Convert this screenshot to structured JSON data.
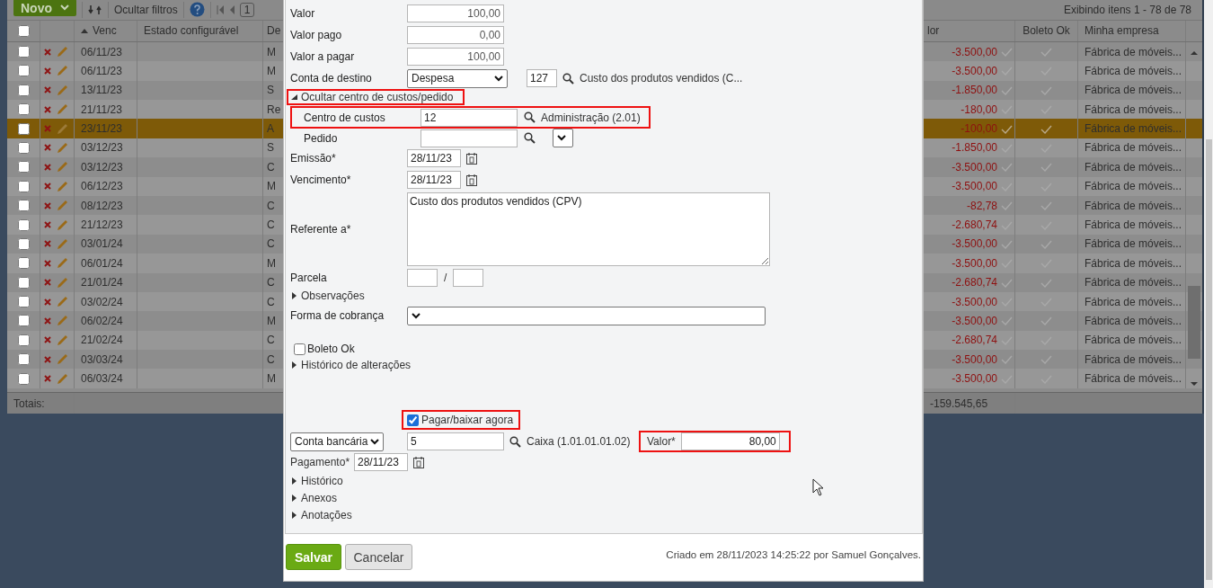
{
  "toolbar": {
    "new_button": "Novo",
    "filter_button": "Ocultar filtros",
    "page": "1",
    "items_info": "Exibindo itens 1 - 78 de 78"
  },
  "grid": {
    "all_checked": false,
    "columns": [
      {
        "label": "Venc",
        "sorted": true
      },
      {
        "label": "Estado configurável",
        "sorted": false
      },
      {
        "label": "De",
        "sorted": false
      },
      {
        "label": "lor",
        "sorted": false
      },
      {
        "label": "Boleto Ok",
        "sorted": false
      },
      {
        "label": "Minha empresa",
        "sorted": false
      }
    ],
    "rows": [
      {
        "selected": false,
        "checked": false,
        "venc": "06/11/23",
        "de": "M",
        "valor": "-3.500,00",
        "empresa": "Fábrica de móveis..."
      },
      {
        "selected": false,
        "checked": false,
        "venc": "06/11/23",
        "de": "M",
        "valor": "-3.500,00",
        "empresa": "Fábrica de móveis..."
      },
      {
        "selected": false,
        "checked": false,
        "venc": "13/11/23",
        "de": "S",
        "valor": "-1.850,00",
        "empresa": "Fábrica de móveis..."
      },
      {
        "selected": false,
        "checked": false,
        "venc": "21/11/23",
        "de": "Re",
        "valor": "-180,00",
        "empresa": "Fábrica de móveis..."
      },
      {
        "selected": true,
        "checked": false,
        "venc": "23/11/23",
        "de": "A",
        "valor": "-100,00",
        "empresa": "Fábrica de móveis..."
      },
      {
        "selected": false,
        "checked": false,
        "venc": "03/12/23",
        "de": "S",
        "valor": "-1.850,00",
        "empresa": "Fábrica de móveis..."
      },
      {
        "selected": false,
        "checked": false,
        "venc": "03/12/23",
        "de": "C",
        "valor": "-3.500,00",
        "empresa": "Fábrica de móveis..."
      },
      {
        "selected": false,
        "checked": false,
        "venc": "06/12/23",
        "de": "M",
        "valor": "-3.500,00",
        "empresa": "Fábrica de móveis..."
      },
      {
        "selected": false,
        "checked": false,
        "venc": "08/12/23",
        "de": "C",
        "valor": "-82,78",
        "empresa": "Fábrica de móveis..."
      },
      {
        "selected": false,
        "checked": false,
        "venc": "21/12/23",
        "de": "C",
        "valor": "-2.680,74",
        "empresa": "Fábrica de móveis..."
      },
      {
        "selected": false,
        "checked": false,
        "venc": "03/01/24",
        "de": "C",
        "valor": "-3.500,00",
        "empresa": "Fábrica de móveis..."
      },
      {
        "selected": false,
        "checked": false,
        "venc": "06/01/24",
        "de": "M",
        "valor": "-3.500,00",
        "empresa": "Fábrica de móveis..."
      },
      {
        "selected": false,
        "checked": false,
        "venc": "21/01/24",
        "de": "C",
        "valor": "-2.680,74",
        "empresa": "Fábrica de móveis..."
      },
      {
        "selected": false,
        "checked": false,
        "venc": "03/02/24",
        "de": "C",
        "valor": "-3.500,00",
        "empresa": "Fábrica de móveis..."
      },
      {
        "selected": false,
        "checked": false,
        "venc": "06/02/24",
        "de": "M",
        "valor": "-3.500,00",
        "empresa": "Fábrica de móveis..."
      },
      {
        "selected": false,
        "checked": false,
        "venc": "21/02/24",
        "de": "C",
        "valor": "-2.680,74",
        "empresa": "Fábrica de móveis..."
      },
      {
        "selected": false,
        "checked": false,
        "venc": "03/03/24",
        "de": "C",
        "valor": "-3.500,00",
        "empresa": "Fábrica de móveis..."
      },
      {
        "selected": false,
        "checked": false,
        "venc": "06/03/24",
        "de": "M",
        "valor": "-3.500,00",
        "empresa": "Fábrica de móveis..."
      }
    ],
    "totals": {
      "label": "Totais:",
      "valor": "-159.545,65"
    }
  },
  "dialog": {
    "amounts": [
      {
        "label": "Valor",
        "value": "100,00"
      },
      {
        "label": "Valor pago",
        "value": "0,00"
      },
      {
        "label": "Valor a pagar",
        "value": "100,00"
      }
    ],
    "destination": {
      "label": "Conta de destino",
      "select": "Despesa",
      "code": "127",
      "description": "Custo dos produtos vendidos (C..."
    },
    "cost_toggle": {
      "label": "Ocultar centro de custos/pedido",
      "expanded": true,
      "highlighted": true
    },
    "cost_center": {
      "label": "Centro de custos",
      "value": "12",
      "description": "Administração (2.01)",
      "highlighted": true
    },
    "order": {
      "label": "Pedido"
    },
    "dates": [
      {
        "label": "Emissão*",
        "value": "28/11/23"
      },
      {
        "label": "Vencimento*",
        "value": "28/11/23"
      }
    ],
    "reference": {
      "label": "Referente a*",
      "value": "Custo dos produtos vendidos (CPV)"
    },
    "installment": {
      "label": "Parcela",
      "separator": "/"
    },
    "observations": {
      "label": "Observações",
      "expanded": false
    },
    "billing": {
      "label": "Forma de cobrança"
    },
    "boleto_ok": {
      "label": "Boleto Ok",
      "checked": false
    },
    "change_history": {
      "label": "Histórico de alterações",
      "expanded": false
    },
    "pay_now": {
      "label": "Pagar/baixar agora",
      "checked": true,
      "highlighted": true
    },
    "payment": {
      "account_type": "Conta bancária",
      "account": "5",
      "account_description": "Caixa (1.01.01.01.02)",
      "amount_label": "Valor*",
      "amount": "80,00",
      "amount_highlighted": true
    },
    "payment_date": {
      "label": "Pagamento*",
      "value": "28/11/23"
    },
    "sections": [
      {
        "label": "Histórico",
        "expanded": false
      },
      {
        "label": "Anexos",
        "expanded": false
      },
      {
        "label": "Anotações",
        "expanded": false
      }
    ],
    "buttons": [
      {
        "label": "Salvar",
        "kind": "primary"
      },
      {
        "label": "Cancelar",
        "kind": "secondary"
      }
    ],
    "created_note": "Criado em 28/11/2023 14:25:22 por Samuel Gonçalves."
  }
}
